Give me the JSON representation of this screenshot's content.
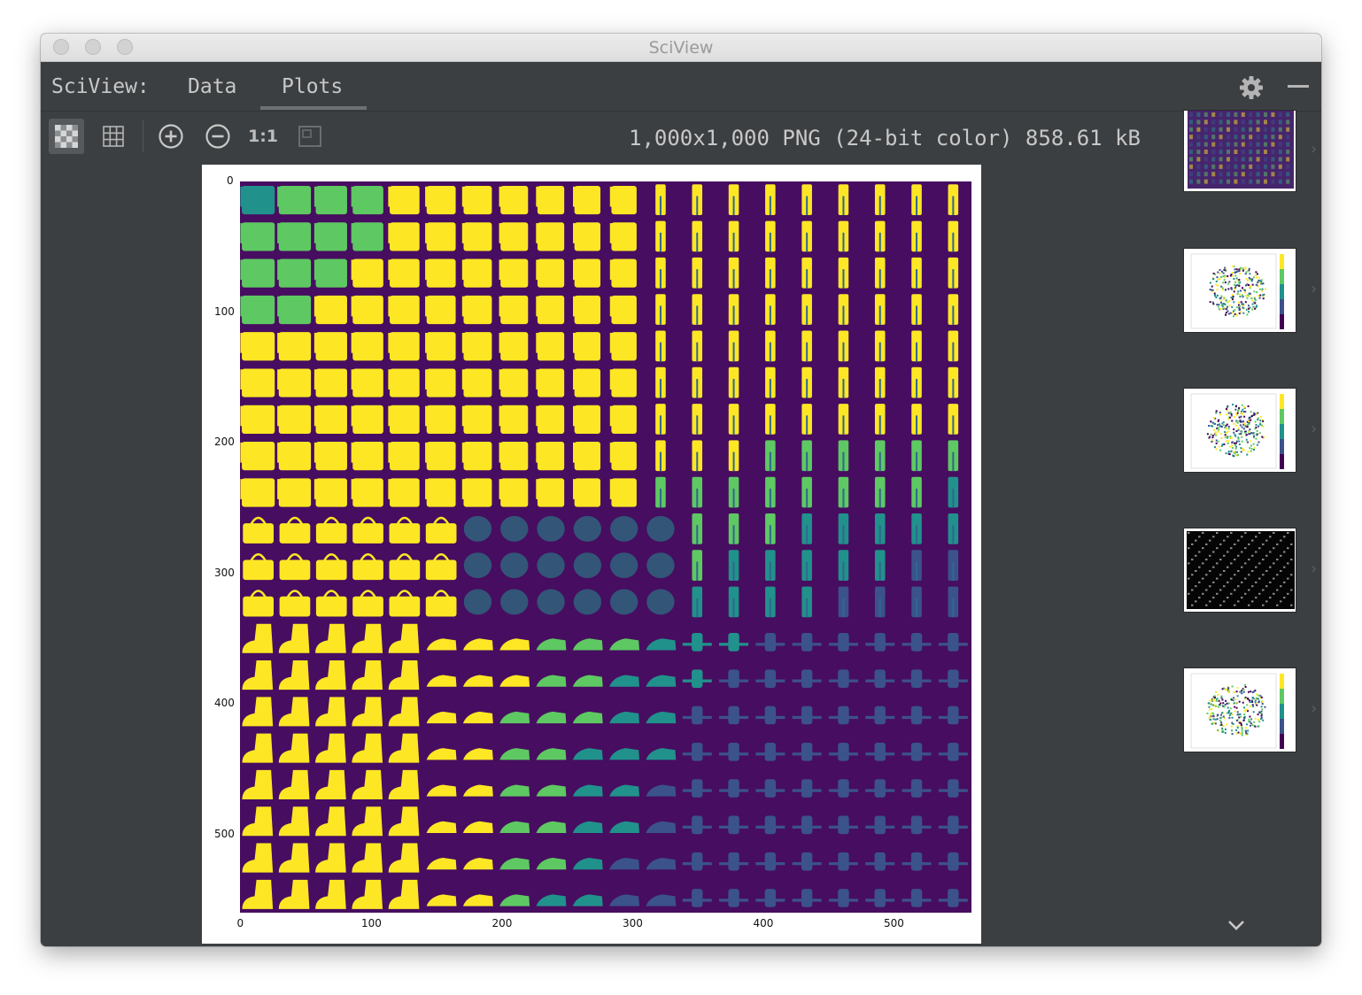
{
  "window": {
    "title": "SciView"
  },
  "tabs": {
    "prefix": "SciView:",
    "items": [
      "Data",
      "Plots"
    ],
    "active": "Plots"
  },
  "toolbar": {
    "buttons": [
      "checkerboard-icon",
      "grid-icon",
      "zoom-in-icon",
      "zoom-out-icon",
      "actual-size-icon",
      "fit-icon"
    ],
    "actual_size_label": "1:1"
  },
  "image_info": "1,000x1,000 PNG (24-bit color) 858.61 kB",
  "plot": {
    "x_ticks": [
      "0",
      "100",
      "200",
      "300",
      "400",
      "500"
    ],
    "y_ticks": [
      "0",
      "100",
      "200",
      "300",
      "400",
      "500"
    ],
    "grid": {
      "rows": 20,
      "cols": 20
    },
    "colormap": [
      "#440154",
      "#3b528b",
      "#21918c",
      "#5ec962",
      "#fde725"
    ]
  },
  "thumbnails": [
    {
      "name": "thumbnail-manifold-grid",
      "kind": "grid"
    },
    {
      "name": "thumbnail-scatter-1",
      "kind": "scatter"
    },
    {
      "name": "thumbnail-scatter-2",
      "kind": "scatter"
    },
    {
      "name": "thumbnail-grayscale-grid",
      "kind": "gray"
    },
    {
      "name": "thumbnail-scatter-3",
      "kind": "scatter"
    }
  ]
}
